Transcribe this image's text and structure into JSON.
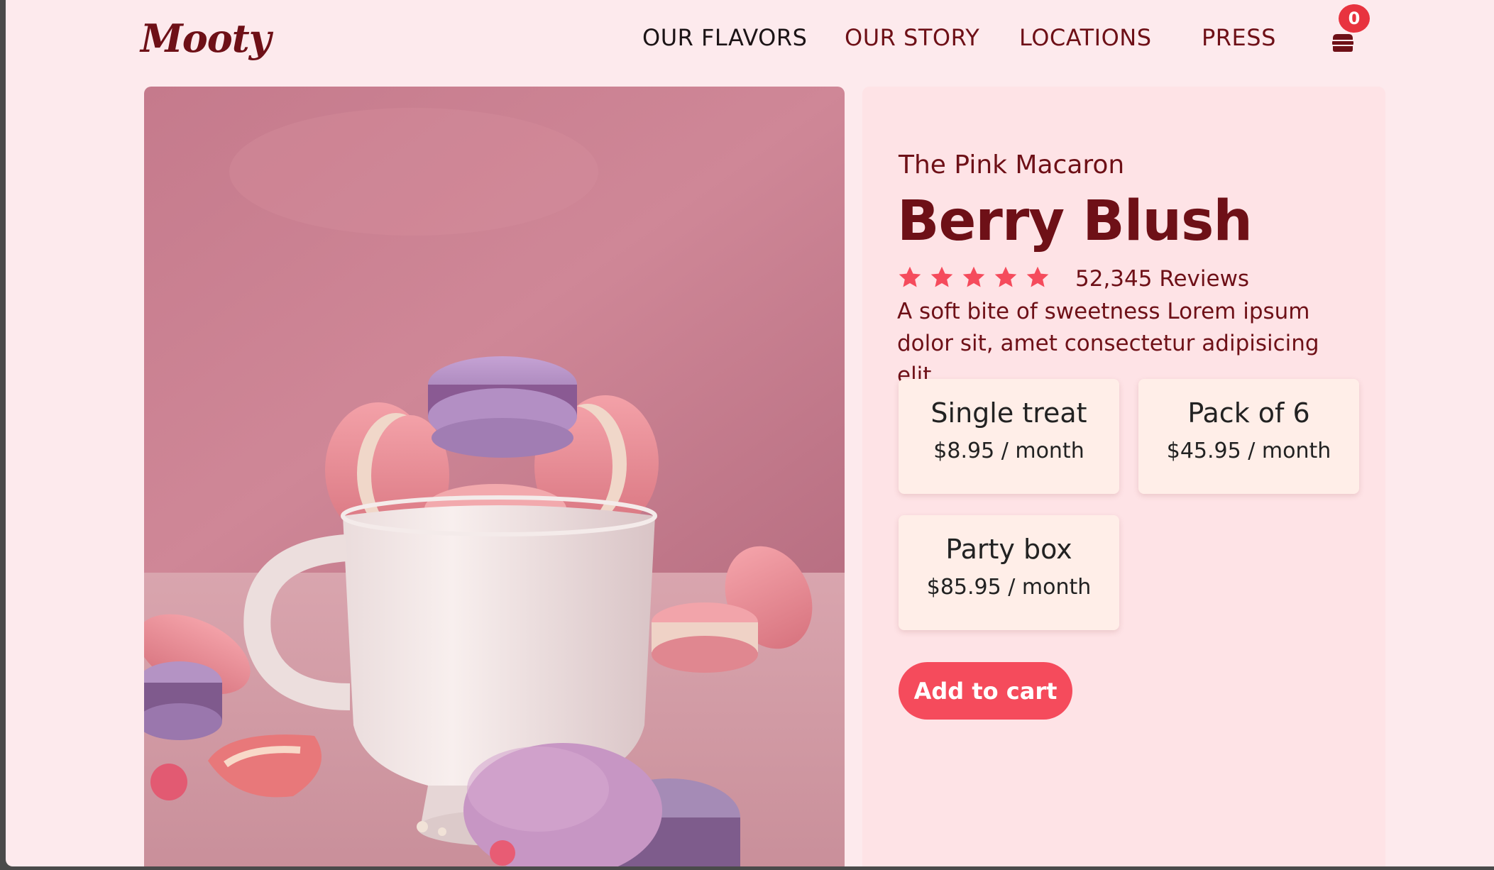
{
  "brand": {
    "logo": "Mooty"
  },
  "nav": [
    {
      "label": "OUR FLAVORS"
    },
    {
      "label": "OUR STORY"
    },
    {
      "label": "LOCATIONS"
    },
    {
      "label": "PRESS"
    }
  ],
  "cart": {
    "count": "0",
    "icon": "cart-icon"
  },
  "product": {
    "subtitle": "The Pink Macaron",
    "name": "Berry Blush",
    "rating": 5,
    "rating_max": 5,
    "reviews": "52,345 Reviews",
    "description": "A soft bite of sweetness Lorem ipsum dolor sit, amet consectetur adipisicing elit.",
    "options": [
      {
        "name": "Single treat",
        "price": "$8.95 / month"
      },
      {
        "name": "Pack of 6",
        "price": "$45.95 / month"
      },
      {
        "name": "Party box",
        "price": "$85.95 / month"
      }
    ],
    "add_to_cart": "Add to cart"
  },
  "colors": {
    "brand": "#6e1017",
    "accent": "#f54b5c",
    "page_bg": "#fdeaed",
    "panel_bg": "#fee3e6",
    "option_bg": "#ffeee8"
  }
}
